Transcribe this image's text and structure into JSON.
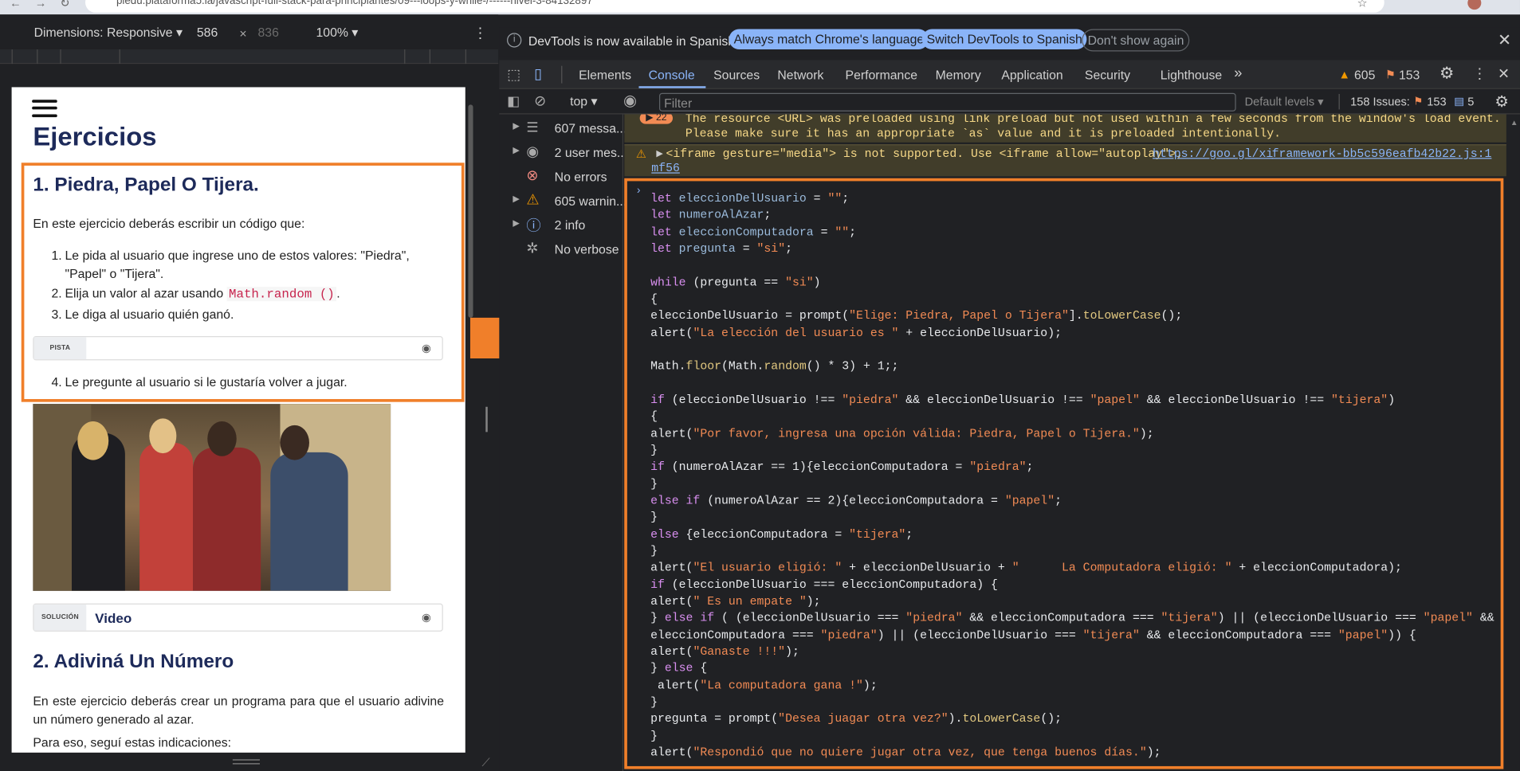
{
  "browser": {
    "url": "piedu.plataforma5.la/javascript-full-stack-para-principiantes/09---loops-y-while-/------nivel-3-84132897"
  },
  "device_toolbar": {
    "dimensions_label": "Dimensions: Responsive",
    "width": "586",
    "times": "×",
    "height": "836",
    "zoom": "100%",
    "more": "⋮"
  },
  "page": {
    "heading": "Ejercicios",
    "ex1_title": "1. Piedra, Papel O Tijera.",
    "ex1_intro": "En este ejercicio deberás escribir un código que:",
    "ex1_item1_num": "1.",
    "ex1_item1": "Le pida al usuario que ingrese uno de estos valores: \"Piedra\", \"Papel\" o \"Tijera\".",
    "ex1_item2_num": "2.",
    "ex1_item2_pre": "Elija un valor al azar usando",
    "ex1_item2_code": "Math.random ()",
    "ex1_item2_post": ".",
    "ex1_item3_num": "3.",
    "ex1_item3": "Le diga al usuario quién ganó.",
    "hint_label": "PISTA",
    "ex1_item4_num": "4.",
    "ex1_item4": "Le pregunte al usuario si le gustaría volver a jugar.",
    "solution_label": "SOLUCIÓN",
    "solution_title": "Video",
    "ex2_title": "2. Adiviná Un Número",
    "ex2_intro": "En este ejercicio deberás crear un programa para que el usuario adivine un número generado al azar.",
    "ex2_intro2": "Para eso, seguí estas indicaciones:"
  },
  "devtools": {
    "info_text": "DevTools is now available in Spanish!",
    "btn_match": "Always match Chrome's language",
    "btn_switch": "Switch DevTools to Spanish",
    "btn_dont_show": "Don't show again",
    "tabs": [
      "Elements",
      "Console",
      "Sources",
      "Network",
      "Performance",
      "Memory",
      "Application",
      "Security",
      "Lighthouse"
    ],
    "active_tab": "Console",
    "more_tabs": "»",
    "warn_count": "605",
    "issue_count": "153",
    "context": "top",
    "filter_placeholder": "Filter",
    "levels": "Default levels",
    "issues_label": "158 Issues:",
    "issues_warn": "153",
    "issues_info": "5",
    "sidebar": [
      "607 messa...",
      "2 user mes...",
      "No errors",
      "605 warnin...",
      "2 info",
      "No verbose"
    ],
    "preload_badge": "22",
    "preload_msg1": "The resource <URL> was preloaded using link preload but not used within a few seconds from the window's load event.",
    "preload_msg2": "Please make sure it has an appropriate `as` value and it is preloaded intentionally.",
    "iframe_msg": "<iframe gesture=\"media\"> is not supported. Use <iframe allow=\"autoplay\">,",
    "iframe_link": "https://goo.gl/xi",
    "iframe_src": "framework-bb5c596eafb42b22.js:1",
    "iframe_src2": "mf56"
  },
  "code_lines": [
    [
      [
        "kw",
        "let "
      ],
      [
        "var",
        "eleccionDelUsuario"
      ],
      [
        "pl",
        " = "
      ],
      [
        "str",
        "\"\""
      ],
      [
        "pl",
        ";"
      ]
    ],
    [
      [
        "kw",
        "let "
      ],
      [
        "var",
        "numeroAlAzar"
      ],
      [
        "pl",
        ";"
      ]
    ],
    [
      [
        "kw",
        "let "
      ],
      [
        "var",
        "eleccionComputadora"
      ],
      [
        "pl",
        " = "
      ],
      [
        "str",
        "\"\""
      ],
      [
        "pl",
        ";"
      ]
    ],
    [
      [
        "kw",
        "let "
      ],
      [
        "var",
        "pregunta"
      ],
      [
        "pl",
        " = "
      ],
      [
        "str",
        "\"si\""
      ],
      [
        "pl",
        ";"
      ]
    ],
    [],
    [
      [
        "kw",
        "while "
      ],
      [
        "pl",
        "(pregunta == "
      ],
      [
        "str",
        "\"si\""
      ],
      [
        "pl",
        ")"
      ]
    ],
    [
      [
        "pl",
        "{"
      ]
    ],
    [
      [
        "pl",
        "eleccionDelUsuario = prompt("
      ],
      [
        "str",
        "\"Elige: Piedra, Papel o Tijera\""
      ],
      [
        "pl",
        "]."
      ],
      [
        "fn",
        "toLowerCase"
      ],
      [
        "pl",
        "();"
      ]
    ],
    [
      [
        "pl",
        "alert("
      ],
      [
        "str",
        "\"La elección del usuario es \""
      ],
      [
        "pl",
        " + eleccionDelUsuario);"
      ]
    ],
    [],
    [
      [
        "pl",
        "Math."
      ],
      [
        "fn",
        "floor"
      ],
      [
        "pl",
        "(Math."
      ],
      [
        "fn",
        "random"
      ],
      [
        "pl",
        "() * 3) + 1;;"
      ]
    ],
    [],
    [
      [
        "kw",
        "if "
      ],
      [
        "pl",
        "(eleccionDelUsuario !== "
      ],
      [
        "str",
        "\"piedra\""
      ],
      [
        "pl",
        " && eleccionDelUsuario !== "
      ],
      [
        "str",
        "\"papel\""
      ],
      [
        "pl",
        " && eleccionDelUsuario !== "
      ],
      [
        "str",
        "\"tijera\""
      ],
      [
        "pl",
        ")"
      ]
    ],
    [
      [
        "pl",
        "{"
      ]
    ],
    [
      [
        "pl",
        "alert("
      ],
      [
        "str",
        "\"Por favor, ingresa una opción válida: Piedra, Papel o Tijera.\""
      ],
      [
        "pl",
        ");"
      ]
    ],
    [
      [
        "pl",
        "}"
      ]
    ],
    [
      [
        "kw",
        "if "
      ],
      [
        "pl",
        "(numeroAlAzar == 1){eleccionComputadora = "
      ],
      [
        "str",
        "\"piedra\""
      ],
      [
        "pl",
        ";"
      ]
    ],
    [
      [
        "pl",
        "}"
      ]
    ],
    [
      [
        "kw",
        "else if "
      ],
      [
        "pl",
        "(numeroAlAzar == 2){eleccionComputadora = "
      ],
      [
        "str",
        "\"papel\""
      ],
      [
        "pl",
        ";"
      ]
    ],
    [
      [
        "pl",
        "}"
      ]
    ],
    [
      [
        "kw",
        "else "
      ],
      [
        "pl",
        "{eleccionComputadora = "
      ],
      [
        "str",
        "\"tijera\""
      ],
      [
        "pl",
        ";"
      ]
    ],
    [
      [
        "pl",
        "}"
      ]
    ],
    [
      [
        "pl",
        "alert("
      ],
      [
        "str",
        "\"El usuario eligió: \""
      ],
      [
        "pl",
        " + eleccionDelUsuario + "
      ],
      [
        "str",
        "\"      La Computadora eligió: \""
      ],
      [
        "pl",
        " + eleccionComputadora);"
      ]
    ],
    [
      [
        "kw",
        "if "
      ],
      [
        "pl",
        "(eleccionDelUsuario === eleccionComputadora) {"
      ]
    ],
    [
      [
        "pl",
        "alert("
      ],
      [
        "str",
        "\" Es un empate \""
      ],
      [
        "pl",
        ");"
      ]
    ],
    [
      [
        "pl",
        "} "
      ],
      [
        "kw",
        "else if "
      ],
      [
        "pl",
        "( (eleccionDelUsuario === "
      ],
      [
        "str",
        "\"piedra\""
      ],
      [
        "pl",
        " && eleccionComputadora === "
      ],
      [
        "str",
        "\"tijera\""
      ],
      [
        "pl",
        ") || (eleccionDelUsuario === "
      ],
      [
        "str",
        "\"papel\""
      ],
      [
        "pl",
        " &&"
      ]
    ],
    [
      [
        "pl",
        "eleccionComputadora === "
      ],
      [
        "str",
        "\"piedra\""
      ],
      [
        "pl",
        ") || (eleccionDelUsuario === "
      ],
      [
        "str",
        "\"tijera\""
      ],
      [
        "pl",
        " && eleccionComputadora === "
      ],
      [
        "str",
        "\"papel\""
      ],
      [
        "pl",
        ")) {"
      ]
    ],
    [
      [
        "pl",
        "alert("
      ],
      [
        "str",
        "\"Ganaste !!!\""
      ],
      [
        "pl",
        ");"
      ]
    ],
    [
      [
        "pl",
        "} "
      ],
      [
        "kw",
        "else "
      ],
      [
        "pl",
        "{"
      ]
    ],
    [
      [
        "pl",
        " alert("
      ],
      [
        "str",
        "\"La computadora gana !\""
      ],
      [
        "pl",
        ");"
      ]
    ],
    [
      [
        "pl",
        "}"
      ]
    ],
    [
      [
        "pl",
        "pregunta = prompt("
      ],
      [
        "str",
        "\"Desea juagar otra vez?\""
      ],
      [
        "pl",
        ")."
      ],
      [
        "fn",
        "toLowerCase"
      ],
      [
        "pl",
        "();"
      ]
    ],
    [
      [
        "pl",
        "}"
      ]
    ],
    [
      [
        "pl",
        "alert("
      ],
      [
        "str",
        "\"Respondió que no quiere jugar otra vez, que tenga buenos días.\""
      ],
      [
        "pl",
        ");"
      ]
    ]
  ],
  "colors": {
    "highlight": "#f07f2a",
    "arrow": "#f07f2a",
    "link_blue": "#8ab4f8",
    "devtools_bg": "#202124"
  }
}
